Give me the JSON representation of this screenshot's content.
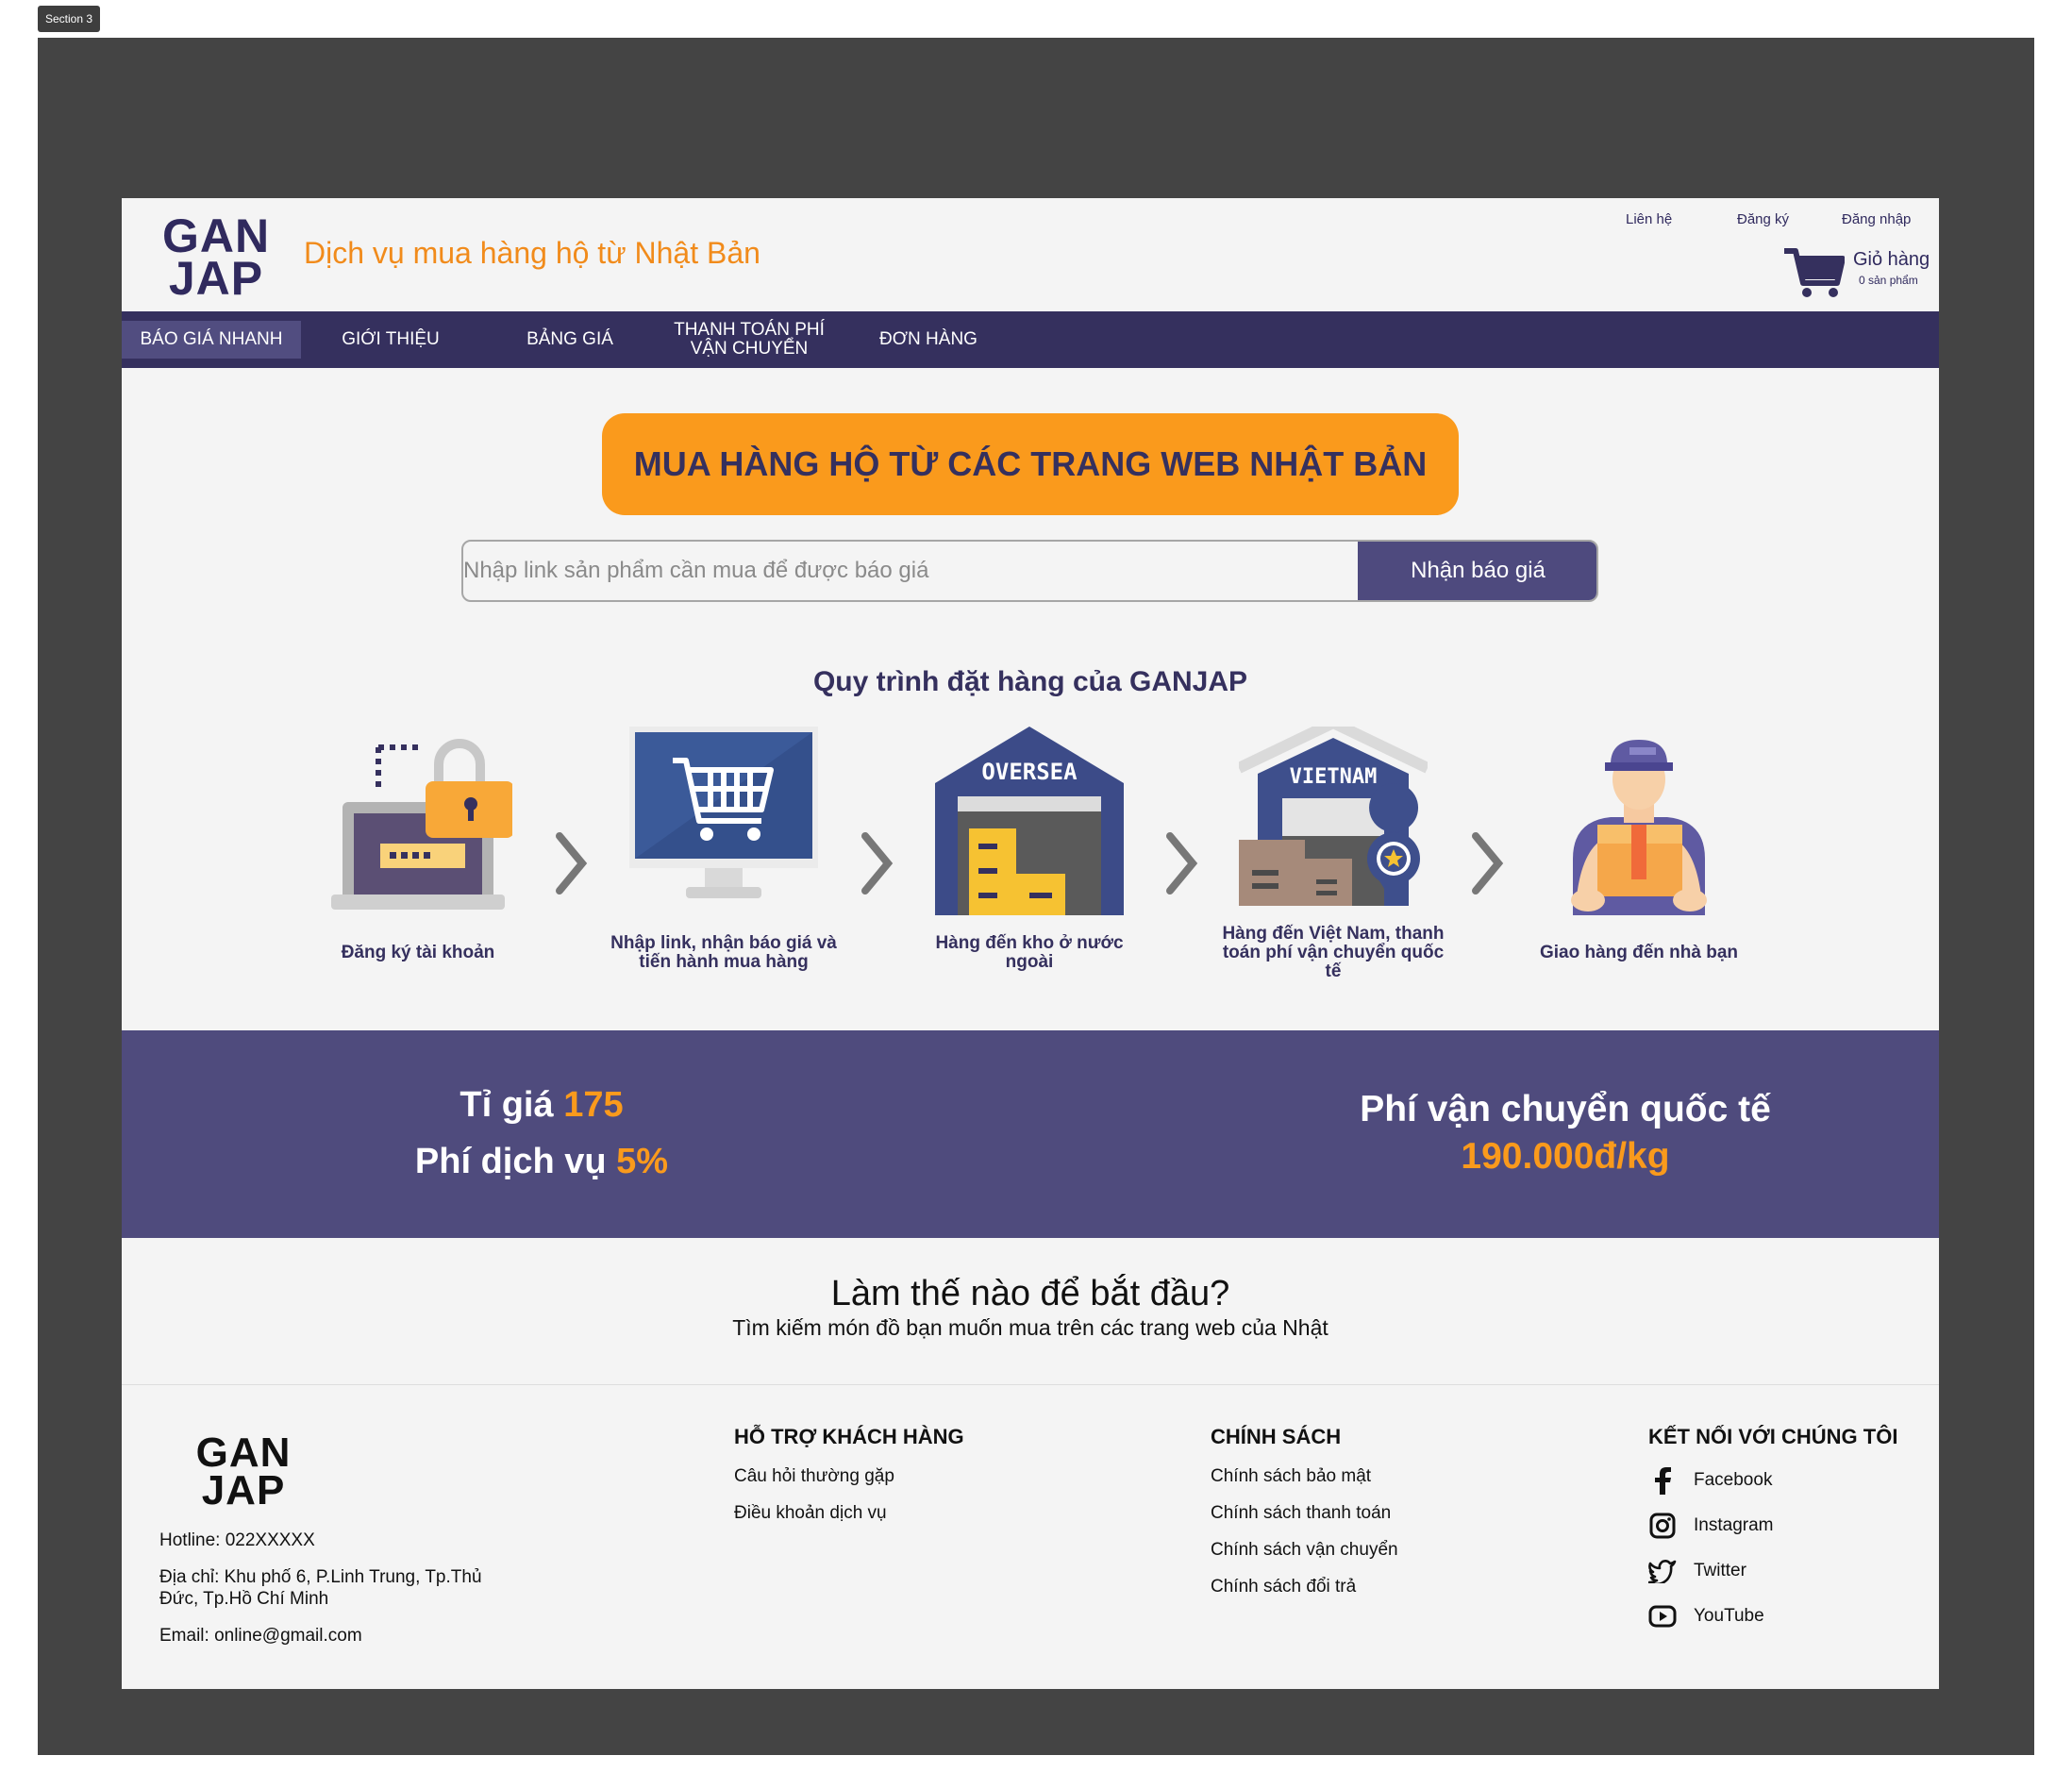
{
  "section_tag": "Section 3",
  "header": {
    "logo_line1": "GAN",
    "logo_line2": "JAP",
    "tagline": "Dịch vụ mua hàng hộ từ Nhật Bản",
    "top_links": [
      "Liên hệ",
      "Đăng ký",
      "Đăng nhập"
    ],
    "cart_label": "Giỏ hàng",
    "cart_count": "0 sản phẩm",
    "cart_icon": "shopping-cart-icon"
  },
  "nav": {
    "items": [
      "BÁO GIÁ NHANH",
      "GIỚI THIỆU",
      "BẢNG GIÁ",
      "THANH TOÁN PHÍ VẬN CHUYỂN",
      "ĐƠN HÀNG"
    ],
    "active_index": 0
  },
  "hero": {
    "banner": "MUA HÀNG HỘ TỪ CÁC TRANG WEB NHẬT BẢN",
    "search_placeholder": "Nhập link sản phẩm cần mua để được báo giá",
    "search_value": "",
    "button": "Nhận báo giá"
  },
  "process": {
    "title": "Quy trình đặt hàng của GANJAP",
    "steps": [
      {
        "label": "Đăng ký tài khoản",
        "icon": "laptop-lock-icon"
      },
      {
        "label": "Nhập link, nhận báo giá và tiến hành mua hàng",
        "icon": "monitor-cart-icon"
      },
      {
        "label": "Hàng đến kho ở nước ngoài",
        "icon": "oversea-warehouse-icon",
        "badge": "OVERSEA"
      },
      {
        "label": "Hàng đến Việt Nam, thanh toán phí vận chuyển quốc tế",
        "icon": "vietnam-warehouse-icon",
        "badge": "VIETNAM"
      },
      {
        "label": "Giao hàng đến nhà bạn",
        "icon": "delivery-person-icon"
      }
    ]
  },
  "stats": {
    "rate_label": "Tỉ giá",
    "rate_value": "175",
    "fee_label": "Phí dịch vụ",
    "fee_value": "5%",
    "shipping_label": "Phí vận chuyển quốc tế",
    "shipping_value": "190.000đ/kg"
  },
  "how_to_start": {
    "title": "Làm thế nào để bắt đầu?",
    "subtitle": "Tìm kiếm món đồ bạn muốn mua trên các trang web của Nhật"
  },
  "footer": {
    "logo_line1": "GAN",
    "logo_line2": "JAP",
    "hotline": "Hotline: 022XXXXX",
    "address": "Địa chỉ: Khu phố 6, P.Linh Trung, Tp.Thủ Đức, Tp.Hồ Chí Minh",
    "email": "Email: online@gmail.com",
    "support_title": "HỖ TRỢ KHÁCH HÀNG",
    "support_links": [
      "Câu hỏi thường gặp",
      "Điều khoản dịch vụ"
    ],
    "policy_title": "CHÍNH SÁCH",
    "policy_links": [
      "Chính sách bảo mật",
      "Chính sách thanh toán",
      "Chính sách vận chuyển",
      "Chính sách đổi trả"
    ],
    "social_title": "KẾT NỐI VỚI CHÚNG TÔI",
    "social": [
      {
        "label": "Facebook",
        "icon": "facebook-icon"
      },
      {
        "label": "Instagram",
        "icon": "instagram-icon"
      },
      {
        "label": "Twitter",
        "icon": "twitter-icon"
      },
      {
        "label": "YouTube",
        "icon": "youtube-icon"
      }
    ]
  },
  "colors": {
    "brand_navy": "#35305e",
    "accent_orange": "#fa9a1c",
    "band_purple": "#4f4b7d",
    "canvas_gray": "#444444"
  }
}
